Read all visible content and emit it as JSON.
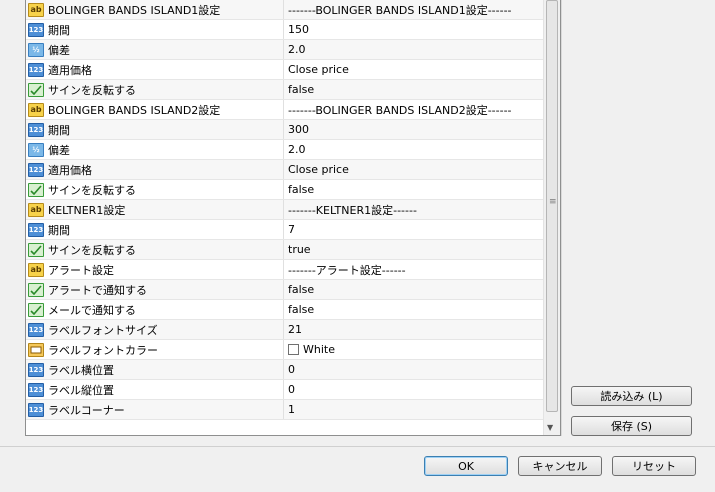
{
  "rows": [
    {
      "icon": "ab",
      "name": "BOLINGER BANDS ISLAND1設定",
      "value": "-------BOLINGER BANDS ISLAND1設定------"
    },
    {
      "icon": "123",
      "name": "期間",
      "value": "150"
    },
    {
      "icon": "half",
      "name": "偏差",
      "value": "2.0"
    },
    {
      "icon": "123",
      "name": "適用価格",
      "value": "Close price"
    },
    {
      "icon": "bool",
      "name": "サインを反転する",
      "value": "false"
    },
    {
      "icon": "ab",
      "name": "BOLINGER BANDS ISLAND2設定",
      "value": "-------BOLINGER BANDS ISLAND2設定------"
    },
    {
      "icon": "123",
      "name": "期間",
      "value": "300"
    },
    {
      "icon": "half",
      "name": "偏差",
      "value": "2.0"
    },
    {
      "icon": "123",
      "name": "適用価格",
      "value": "Close price"
    },
    {
      "icon": "bool",
      "name": "サインを反転する",
      "value": "false"
    },
    {
      "icon": "ab",
      "name": "KELTNER1設定",
      "value": "-------KELTNER1設定------"
    },
    {
      "icon": "123",
      "name": "期間",
      "value": "7"
    },
    {
      "icon": "bool",
      "name": "サインを反転する",
      "value": "true"
    },
    {
      "icon": "ab",
      "name": "アラート設定",
      "value": "-------アラート設定------"
    },
    {
      "icon": "bool",
      "name": "アラートで通知する",
      "value": "false"
    },
    {
      "icon": "bool",
      "name": "メールで通知する",
      "value": "false"
    },
    {
      "icon": "123",
      "name": "ラベルフォントサイズ",
      "value": "21"
    },
    {
      "icon": "color",
      "name": "ラベルフォントカラー",
      "value": "White",
      "swatch": "#ffffff"
    },
    {
      "icon": "123",
      "name": "ラベル横位置",
      "value": "0"
    },
    {
      "icon": "123",
      "name": "ラベル縦位置",
      "value": "0"
    },
    {
      "icon": "123",
      "name": "ラベルコーナー",
      "value": "1"
    }
  ],
  "icon_text": {
    "ab": "ab",
    "123": "123",
    "half": "½"
  },
  "buttons": {
    "load": "読み込み (L)",
    "save": "保存 (S)",
    "ok": "OK",
    "cancel": "キャンセル",
    "reset": "リセット"
  }
}
